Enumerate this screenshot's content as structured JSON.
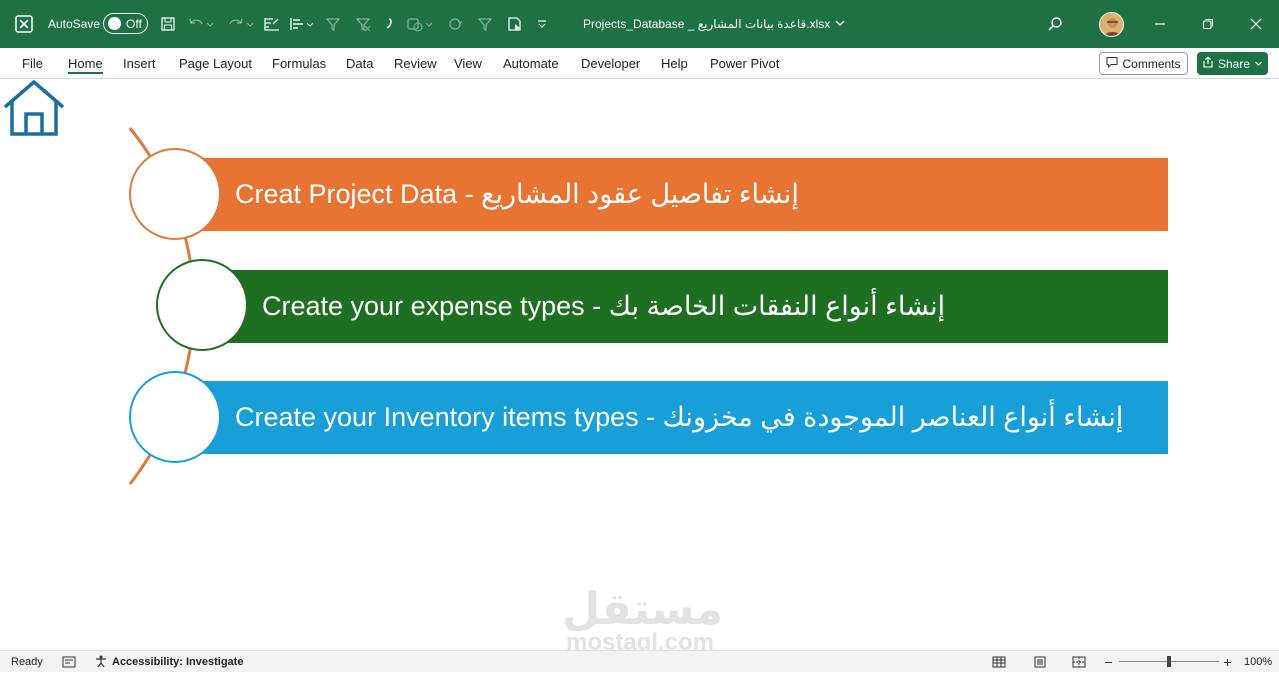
{
  "titlebar": {
    "autosave_label": "AutoSave",
    "autosave_state": "Off",
    "filename": "Projects_Database _ قاعدة بيانات المشاريع.xlsx",
    "accent": "#1e7145",
    "icons": [
      "excel-icon",
      "save-icon",
      "undo-icon",
      "redo-icon",
      "form-icon",
      "align-icon",
      "filter-clear-icon",
      "filter-icon",
      "paint-icon",
      "shapes-icon",
      "refresh-icon",
      "funnel-icon",
      "copy-format-icon",
      "customize-icon",
      "search-icon",
      "minimize-icon",
      "restore-icon",
      "close-icon"
    ]
  },
  "ribbon": {
    "tabs": [
      {
        "label": "File"
      },
      {
        "label": "Home"
      },
      {
        "label": "Insert"
      },
      {
        "label": "Page Layout"
      },
      {
        "label": "Formulas"
      },
      {
        "label": "Data"
      },
      {
        "label": "Review"
      },
      {
        "label": "View"
      },
      {
        "label": "Automate"
      },
      {
        "label": "Developer"
      },
      {
        "label": "Help"
      },
      {
        "label": "Power Pivot"
      }
    ],
    "active_tab": "Home",
    "comments_label": "Comments",
    "share_label": "Share"
  },
  "sheet": {
    "items": [
      {
        "label": "Creat Project Data - إنشاء تفاصيل عقود المشاريع",
        "color": "#e87434"
      },
      {
        "label": "Create your expense types - إنشاء أنواع النفقات الخاصة بك",
        "color": "#1e6f22"
      },
      {
        "label": "Create your Inventory items types - إنشاء أنواع العناصر الموجودة في مخزونك",
        "color": "#189fd8"
      }
    ],
    "watermark_ar": "مستقل",
    "watermark_en": "mostaql.com"
  },
  "statusbar": {
    "ready": "Ready",
    "accessibility": "Accessibility: Investigate",
    "zoom": "100%"
  }
}
